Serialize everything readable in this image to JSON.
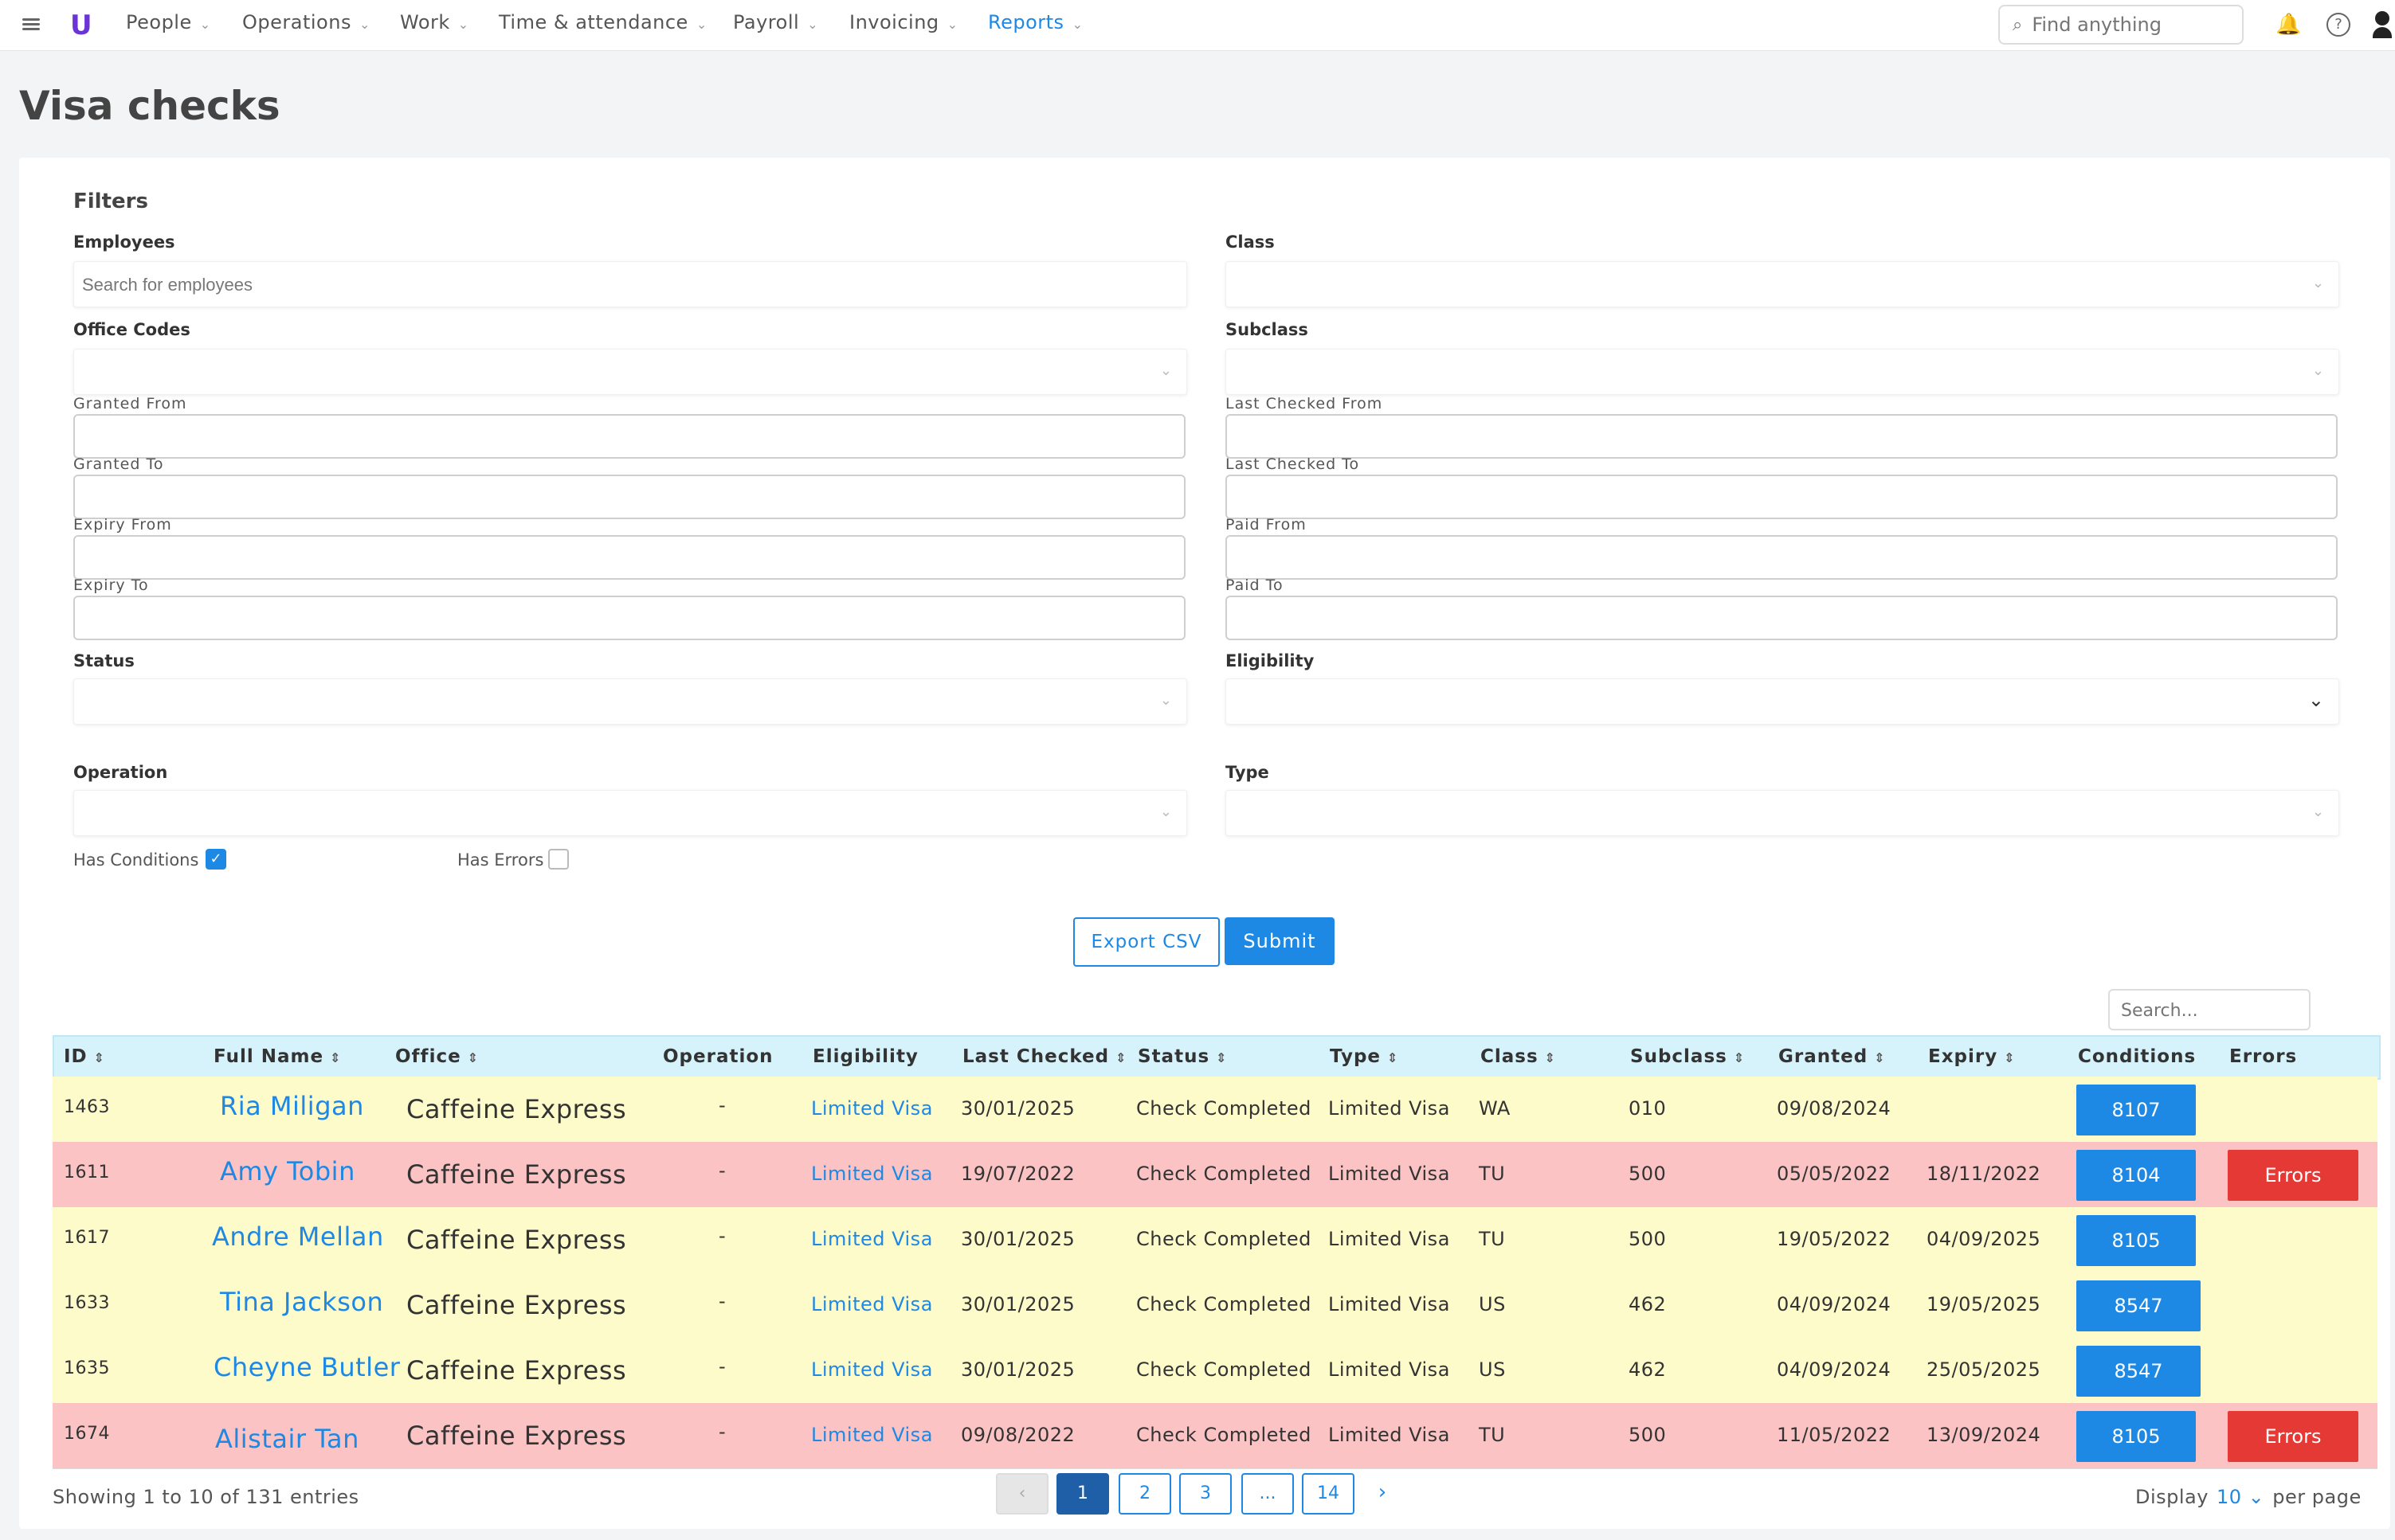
{
  "nav": {
    "logo": "U",
    "items": [
      {
        "label": "People"
      },
      {
        "label": "Operations"
      },
      {
        "label": "Work"
      },
      {
        "label": "Time & attendance"
      },
      {
        "label": "Payroll"
      },
      {
        "label": "Invoicing"
      },
      {
        "label": "Reports"
      }
    ],
    "active": "Reports",
    "search_placeholder": "Find anything"
  },
  "page": {
    "title": "Visa checks"
  },
  "filters": {
    "title": "Filters",
    "employees_label": "Employees",
    "employees_placeholder": "Search for employees",
    "class_label": "Class",
    "office_codes_label": "Office Codes",
    "subclass_label": "Subclass",
    "granted_from_label": "Granted From",
    "last_checked_from_label": "Last Checked From",
    "granted_to_label": "Granted To",
    "last_checked_to_label": "Last Checked To",
    "expiry_from_label": "Expiry From",
    "paid_from_label": "Paid From",
    "expiry_to_label": "Expiry To",
    "paid_to_label": "Paid To",
    "status_label": "Status",
    "eligibility_label": "Eligibility",
    "operation_label": "Operation",
    "type_label": "Type",
    "has_conditions_label": "Has Conditions",
    "has_conditions_checked": true,
    "has_errors_label": "Has Errors",
    "has_errors_checked": false
  },
  "actions": {
    "export_label": "Export CSV",
    "submit_label": "Submit",
    "table_search_placeholder": "Search..."
  },
  "table": {
    "columns": [
      "ID",
      "Full Name",
      "Office",
      "Operation",
      "Eligibility",
      "Last Checked",
      "Status",
      "Type",
      "Class",
      "Subclass",
      "Granted",
      "Expiry",
      "Conditions",
      "Errors"
    ],
    "rows": [
      {
        "id": "1463",
        "name": "Ria Miligan",
        "office": "Caffeine Express",
        "operation": "-",
        "eligibility": "Limited Visa",
        "last_checked": "30/01/2025",
        "status": "Check Completed",
        "type": "Limited Visa",
        "class": "WA",
        "subclass": "010",
        "granted": "09/08/2024",
        "expiry": "",
        "conditions": "8107",
        "errors": "",
        "has_error": false
      },
      {
        "id": "1611",
        "name": "Amy Tobin",
        "office": "Caffeine Express",
        "operation": "-",
        "eligibility": "Limited Visa",
        "last_checked": "19/07/2022",
        "status": "Check Completed",
        "type": "Limited Visa",
        "class": "TU",
        "subclass": "500",
        "granted": "05/05/2022",
        "expiry": "18/11/2022",
        "conditions": "8104",
        "errors": "Errors",
        "has_error": true
      },
      {
        "id": "1617",
        "name": "Andre Mellan",
        "office": "Caffeine Express",
        "operation": "-",
        "eligibility": "Limited Visa",
        "last_checked": "30/01/2025",
        "status": "Check Completed",
        "type": "Limited Visa",
        "class": "TU",
        "subclass": "500",
        "granted": "19/05/2022",
        "expiry": "04/09/2025",
        "conditions": "8105",
        "errors": "",
        "has_error": false
      },
      {
        "id": "1633",
        "name": "Tina Jackson",
        "office": "Caffeine Express",
        "operation": "-",
        "eligibility": "Limited Visa",
        "last_checked": "30/01/2025",
        "status": "Check Completed",
        "type": "Limited Visa",
        "class": "US",
        "subclass": "462",
        "granted": "04/09/2024",
        "expiry": "19/05/2025",
        "conditions": "8547",
        "errors": "",
        "has_error": false
      },
      {
        "id": "1635",
        "name": "Cheyne Butler",
        "office": "Caffeine Express",
        "operation": "-",
        "eligibility": "Limited Visa",
        "last_checked": "30/01/2025",
        "status": "Check Completed",
        "type": "Limited Visa",
        "class": "US",
        "subclass": "462",
        "granted": "04/09/2024",
        "expiry": "25/05/2025",
        "conditions": "8547",
        "errors": "",
        "has_error": false
      },
      {
        "id": "1674",
        "name": "Alistair Tan",
        "office": "Caffeine Express",
        "operation": "-",
        "eligibility": "Limited Visa",
        "last_checked": "09/08/2022",
        "status": "Check Completed",
        "type": "Limited Visa",
        "class": "TU",
        "subclass": "500",
        "granted": "11/05/2022",
        "expiry": "13/09/2024",
        "conditions": "8105",
        "errors": "Errors",
        "has_error": true
      }
    ]
  },
  "footer": {
    "showing": "Showing 1 to 10 of 131 entries",
    "pages": [
      "1",
      "2",
      "3",
      "...",
      "14"
    ],
    "current_page": "1",
    "display_label": "Display",
    "display_value": "10",
    "per_page_label": "per page"
  },
  "colors": {
    "accent": "#1e88e5",
    "error": "#e53935",
    "row_ok": "#fdfbca",
    "row_error": "#fbc3c3",
    "header_bg": "#d6f2fb"
  }
}
